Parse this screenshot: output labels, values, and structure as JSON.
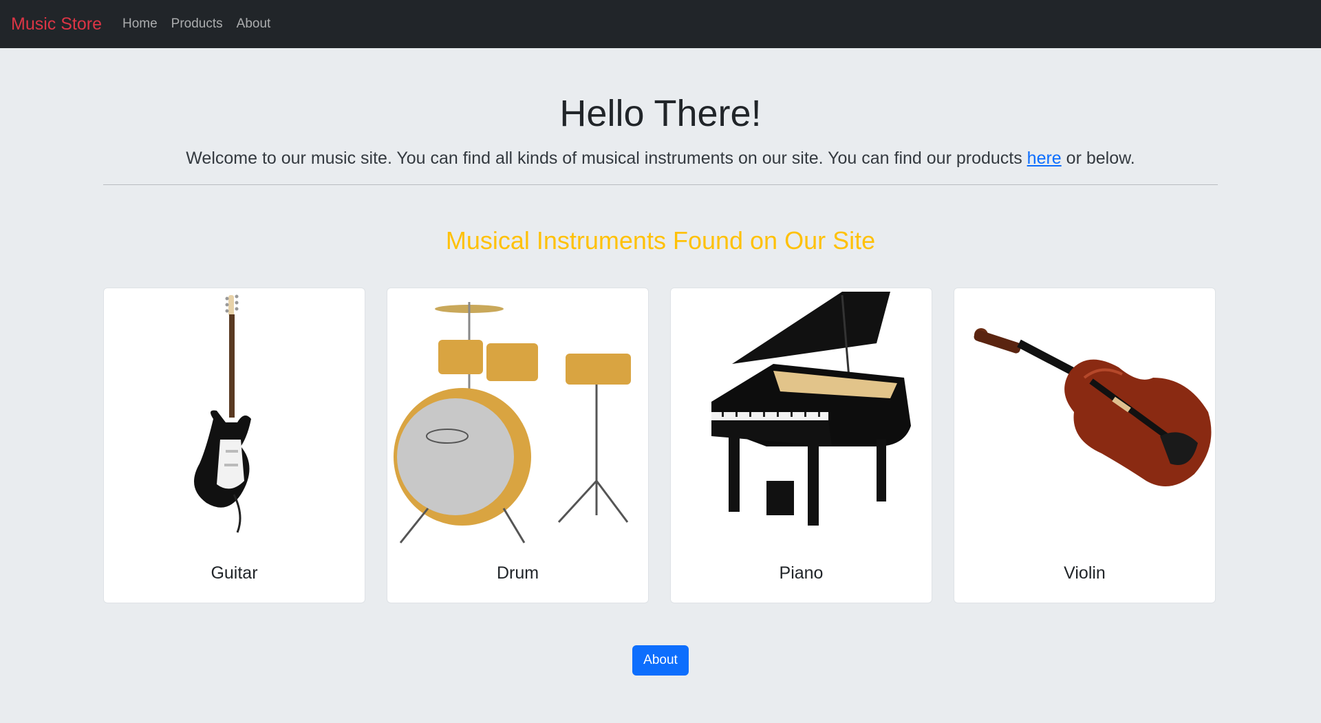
{
  "navbar": {
    "brand": "Music Store",
    "links": [
      "Home",
      "Products",
      "About"
    ]
  },
  "hero": {
    "title": "Hello There!",
    "lead_before": "Welcome to our music site. You can find all kinds of musical instruments on our site. You can find our products ",
    "lead_link": "here",
    "lead_after": " or below."
  },
  "section": {
    "title": "Musical Instruments Found on Our Site"
  },
  "cards": [
    {
      "title": "Guitar",
      "icon": "guitar-image"
    },
    {
      "title": "Drum",
      "icon": "drum-image"
    },
    {
      "title": "Piano",
      "icon": "piano-image"
    },
    {
      "title": "Violin",
      "icon": "violin-image"
    }
  ],
  "button": {
    "label": "About"
  },
  "colors": {
    "navbar_bg": "#212529",
    "brand": "#dc3545",
    "section_title": "#ffc107",
    "button": "#0d6efd",
    "page_bg": "#e9ecef"
  }
}
